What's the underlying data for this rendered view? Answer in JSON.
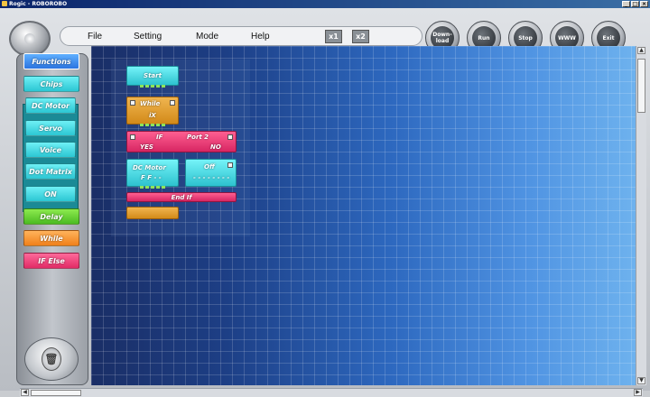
{
  "window": {
    "title": "Rogic - ROBOROBO"
  },
  "menu": {
    "items": [
      "File",
      "Setting",
      "Mode",
      "Help"
    ]
  },
  "zoom": {
    "x1": "x1",
    "x2": "x2"
  },
  "toolbar": {
    "download": "Down-load",
    "run": "Run",
    "stop": "Stop",
    "www": "WWW",
    "exit": "Exit"
  },
  "palette": {
    "functions": "Functions",
    "chips": "Chips",
    "dc_motor": "DC Motor",
    "servo": "Servo",
    "voice": "Voice",
    "dot_matrix": "Dot Matrix",
    "on": "ON",
    "delay": "Delay",
    "while": "While",
    "if_else": "IF Else"
  },
  "blocks": {
    "start": "Start",
    "while_label": "While",
    "while_value": "iX",
    "if_label": "IF",
    "if_port": "Port 2",
    "yes": "YES",
    "no": "NO",
    "dc_motor_label": "DC Motor",
    "dc_motor_value": "F F - -",
    "off_label": "Off",
    "off_value": "- - - - - - - -",
    "end_if": "End If"
  },
  "colors": {
    "canvas_dark": "#1a2e66",
    "canvas_light": "#6eb2ee",
    "chip_cyan": "#2dc2cf",
    "loop_orange": "#d28a19",
    "if_pink": "#d72663",
    "delay_green": "#4bbb22",
    "functions_blue": "#2b74e0"
  },
  "icons": {
    "trash": "trash-can-icon",
    "app": "app-icon"
  }
}
